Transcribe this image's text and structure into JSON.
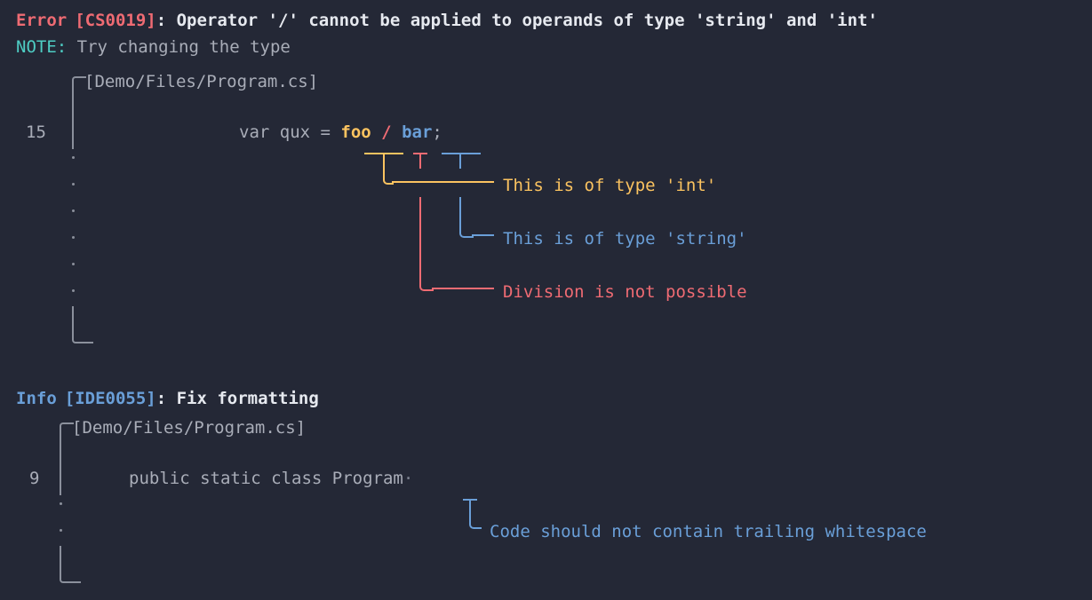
{
  "theme": {
    "background": "#242836",
    "error_color": "#ef6b73",
    "note_color": "#4ecdc4",
    "info_color": "#6a9fd8",
    "text_color": "#a9adb8",
    "bright_text_color": "#e6e9ef",
    "orange_color": "#fbc360",
    "gutter_color": "#8b909c"
  },
  "diagnostics": [
    {
      "severity": "Error",
      "code": "[CS0019]",
      "separator": ":",
      "message": " Operator '/' cannot be applied to operands of type 'string' and 'int'",
      "note_label": "NOTE:",
      "note_text": " Try changing the type",
      "file": "[Demo/Files/Program.cs]",
      "line_number": "15",
      "source_segments": [
        {
          "text": "var qux = ",
          "color": "grey"
        },
        {
          "text": "foo",
          "color": "orange"
        },
        {
          "text": " ",
          "color": "grey"
        },
        {
          "text": "/",
          "color": "red"
        },
        {
          "text": " ",
          "color": "grey"
        },
        {
          "text": "bar",
          "color": "blue"
        },
        {
          "text": ";",
          "color": "grey"
        }
      ],
      "annotations": [
        {
          "label": "This is of type 'int'",
          "color": "orange"
        },
        {
          "label": "This is of type 'string'",
          "color": "blue"
        },
        {
          "label": "Division is not possible",
          "color": "red"
        }
      ]
    },
    {
      "severity": "Info",
      "code": "[IDE0055]",
      "separator": ":",
      "message": " Fix formatting",
      "file": "[Demo/Files/Program.cs]",
      "line_number": "9",
      "source_segments": [
        {
          "text": "public static class Program",
          "color": "grey"
        },
        {
          "text": "·",
          "color": "dim"
        }
      ],
      "annotations": [
        {
          "label": "Code should not contain trailing whitespace",
          "color": "blue"
        }
      ]
    }
  ]
}
